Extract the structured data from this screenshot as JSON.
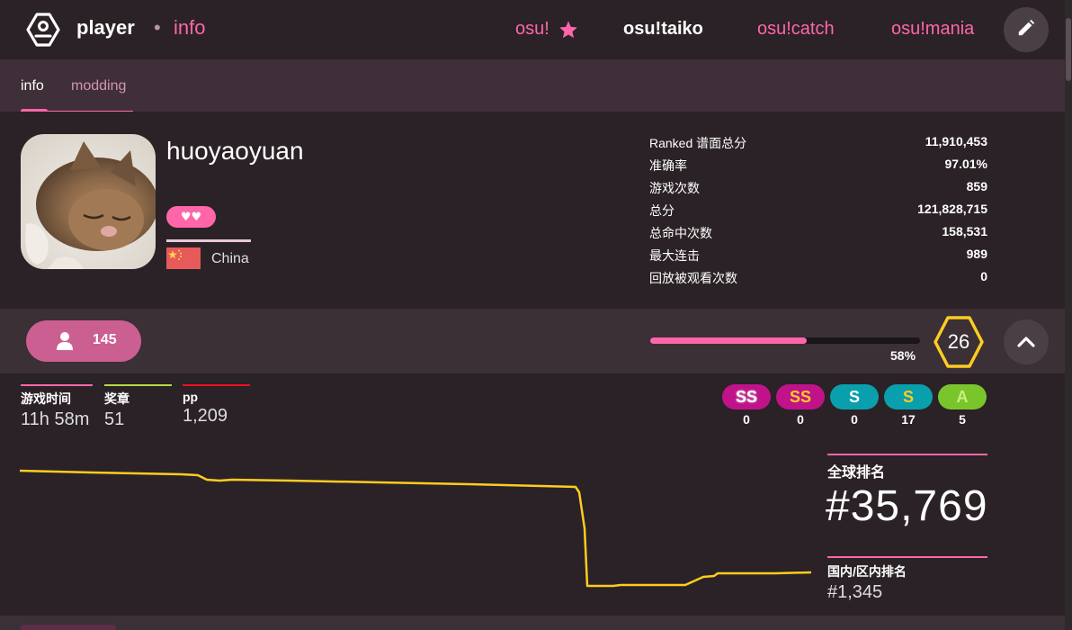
{
  "header": {
    "brand": "player",
    "separator": "•",
    "section": "info",
    "modes": [
      {
        "label": "osu!",
        "active": false
      },
      {
        "label": "osu!taiko",
        "active": true
      },
      {
        "label": "osu!catch",
        "active": false
      },
      {
        "label": "osu!mania",
        "active": false
      }
    ]
  },
  "tabs": {
    "info": "info",
    "modding": "modding"
  },
  "profile": {
    "username": "huoyaoyuan",
    "supporter": "♥♥",
    "country": "China"
  },
  "stats": [
    {
      "label": "Ranked 谱面总分",
      "value": "11,910,453"
    },
    {
      "label": "准确率",
      "value": "97.01%"
    },
    {
      "label": "游戏次数",
      "value": "859"
    },
    {
      "label": "总分",
      "value": "121,828,715"
    },
    {
      "label": "总命中次数",
      "value": "158,531"
    },
    {
      "label": "最大连击",
      "value": "989"
    },
    {
      "label": "回放被观看次数",
      "value": "0"
    }
  ],
  "level": {
    "friends_count": "145",
    "progress_label": "58%",
    "progress": 0.58,
    "level": "26"
  },
  "mini_stats": [
    {
      "label": "游戏时间",
      "value": "11h 58m",
      "color": "#ff66aa"
    },
    {
      "label": "奖章",
      "value": "51",
      "color": "#b3d944"
    },
    {
      "label": "pp",
      "value": "1,209",
      "color": "#ed1121"
    }
  ],
  "grades": [
    {
      "label": "SS",
      "count": "0"
    },
    {
      "label": "SS",
      "count": "0"
    },
    {
      "label": "S",
      "count": "0"
    },
    {
      "label": "S",
      "count": "17"
    },
    {
      "label": "A",
      "count": "5"
    }
  ],
  "ranks": {
    "global_label": "全球排名",
    "global_value": "#35,769",
    "country_label": "国内/区内排名",
    "country_value": "#1,345"
  },
  "colors": {
    "accent": "#ff66aa",
    "graph_line": "#ffcc22",
    "level_ring": "#ffcc22"
  }
}
